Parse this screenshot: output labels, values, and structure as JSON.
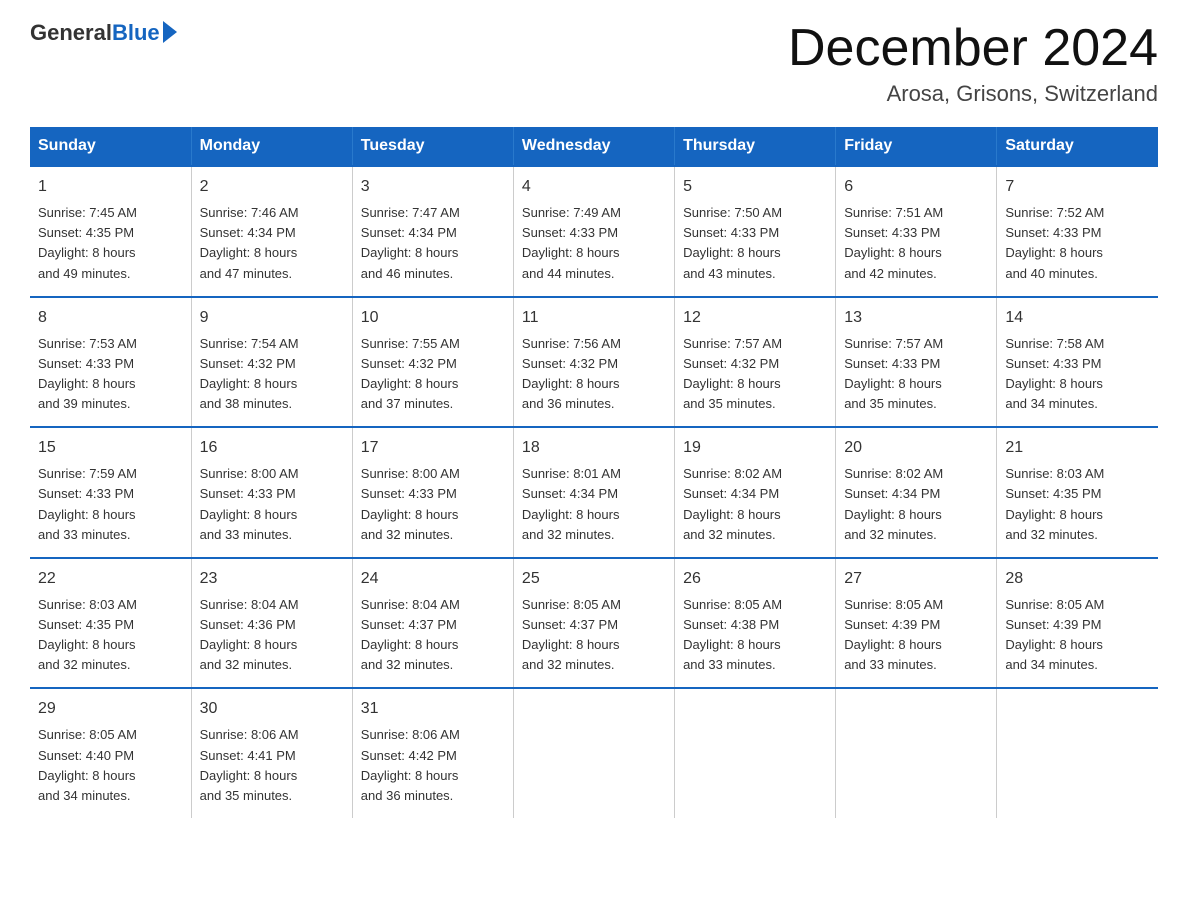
{
  "header": {
    "logo_general": "General",
    "logo_blue": "Blue",
    "title": "December 2024",
    "subtitle": "Arosa, Grisons, Switzerland"
  },
  "weekdays": [
    "Sunday",
    "Monday",
    "Tuesday",
    "Wednesday",
    "Thursday",
    "Friday",
    "Saturday"
  ],
  "weeks": [
    [
      {
        "day": "1",
        "sunrise": "7:45 AM",
        "sunset": "4:35 PM",
        "daylight": "8 hours and 49 minutes."
      },
      {
        "day": "2",
        "sunrise": "7:46 AM",
        "sunset": "4:34 PM",
        "daylight": "8 hours and 47 minutes."
      },
      {
        "day": "3",
        "sunrise": "7:47 AM",
        "sunset": "4:34 PM",
        "daylight": "8 hours and 46 minutes."
      },
      {
        "day": "4",
        "sunrise": "7:49 AM",
        "sunset": "4:33 PM",
        "daylight": "8 hours and 44 minutes."
      },
      {
        "day": "5",
        "sunrise": "7:50 AM",
        "sunset": "4:33 PM",
        "daylight": "8 hours and 43 minutes."
      },
      {
        "day": "6",
        "sunrise": "7:51 AM",
        "sunset": "4:33 PM",
        "daylight": "8 hours and 42 minutes."
      },
      {
        "day": "7",
        "sunrise": "7:52 AM",
        "sunset": "4:33 PM",
        "daylight": "8 hours and 40 minutes."
      }
    ],
    [
      {
        "day": "8",
        "sunrise": "7:53 AM",
        "sunset": "4:33 PM",
        "daylight": "8 hours and 39 minutes."
      },
      {
        "day": "9",
        "sunrise": "7:54 AM",
        "sunset": "4:32 PM",
        "daylight": "8 hours and 38 minutes."
      },
      {
        "day": "10",
        "sunrise": "7:55 AM",
        "sunset": "4:32 PM",
        "daylight": "8 hours and 37 minutes."
      },
      {
        "day": "11",
        "sunrise": "7:56 AM",
        "sunset": "4:32 PM",
        "daylight": "8 hours and 36 minutes."
      },
      {
        "day": "12",
        "sunrise": "7:57 AM",
        "sunset": "4:32 PM",
        "daylight": "8 hours and 35 minutes."
      },
      {
        "day": "13",
        "sunrise": "7:57 AM",
        "sunset": "4:33 PM",
        "daylight": "8 hours and 35 minutes."
      },
      {
        "day": "14",
        "sunrise": "7:58 AM",
        "sunset": "4:33 PM",
        "daylight": "8 hours and 34 minutes."
      }
    ],
    [
      {
        "day": "15",
        "sunrise": "7:59 AM",
        "sunset": "4:33 PM",
        "daylight": "8 hours and 33 minutes."
      },
      {
        "day": "16",
        "sunrise": "8:00 AM",
        "sunset": "4:33 PM",
        "daylight": "8 hours and 33 minutes."
      },
      {
        "day": "17",
        "sunrise": "8:00 AM",
        "sunset": "4:33 PM",
        "daylight": "8 hours and 32 minutes."
      },
      {
        "day": "18",
        "sunrise": "8:01 AM",
        "sunset": "4:34 PM",
        "daylight": "8 hours and 32 minutes."
      },
      {
        "day": "19",
        "sunrise": "8:02 AM",
        "sunset": "4:34 PM",
        "daylight": "8 hours and 32 minutes."
      },
      {
        "day": "20",
        "sunrise": "8:02 AM",
        "sunset": "4:34 PM",
        "daylight": "8 hours and 32 minutes."
      },
      {
        "day": "21",
        "sunrise": "8:03 AM",
        "sunset": "4:35 PM",
        "daylight": "8 hours and 32 minutes."
      }
    ],
    [
      {
        "day": "22",
        "sunrise": "8:03 AM",
        "sunset": "4:35 PM",
        "daylight": "8 hours and 32 minutes."
      },
      {
        "day": "23",
        "sunrise": "8:04 AM",
        "sunset": "4:36 PM",
        "daylight": "8 hours and 32 minutes."
      },
      {
        "day": "24",
        "sunrise": "8:04 AM",
        "sunset": "4:37 PM",
        "daylight": "8 hours and 32 minutes."
      },
      {
        "day": "25",
        "sunrise": "8:05 AM",
        "sunset": "4:37 PM",
        "daylight": "8 hours and 32 minutes."
      },
      {
        "day": "26",
        "sunrise": "8:05 AM",
        "sunset": "4:38 PM",
        "daylight": "8 hours and 33 minutes."
      },
      {
        "day": "27",
        "sunrise": "8:05 AM",
        "sunset": "4:39 PM",
        "daylight": "8 hours and 33 minutes."
      },
      {
        "day": "28",
        "sunrise": "8:05 AM",
        "sunset": "4:39 PM",
        "daylight": "8 hours and 34 minutes."
      }
    ],
    [
      {
        "day": "29",
        "sunrise": "8:05 AM",
        "sunset": "4:40 PM",
        "daylight": "8 hours and 34 minutes."
      },
      {
        "day": "30",
        "sunrise": "8:06 AM",
        "sunset": "4:41 PM",
        "daylight": "8 hours and 35 minutes."
      },
      {
        "day": "31",
        "sunrise": "8:06 AM",
        "sunset": "4:42 PM",
        "daylight": "8 hours and 36 minutes."
      },
      null,
      null,
      null,
      null
    ]
  ],
  "labels": {
    "sunrise": "Sunrise:",
    "sunset": "Sunset:",
    "daylight": "Daylight:"
  }
}
